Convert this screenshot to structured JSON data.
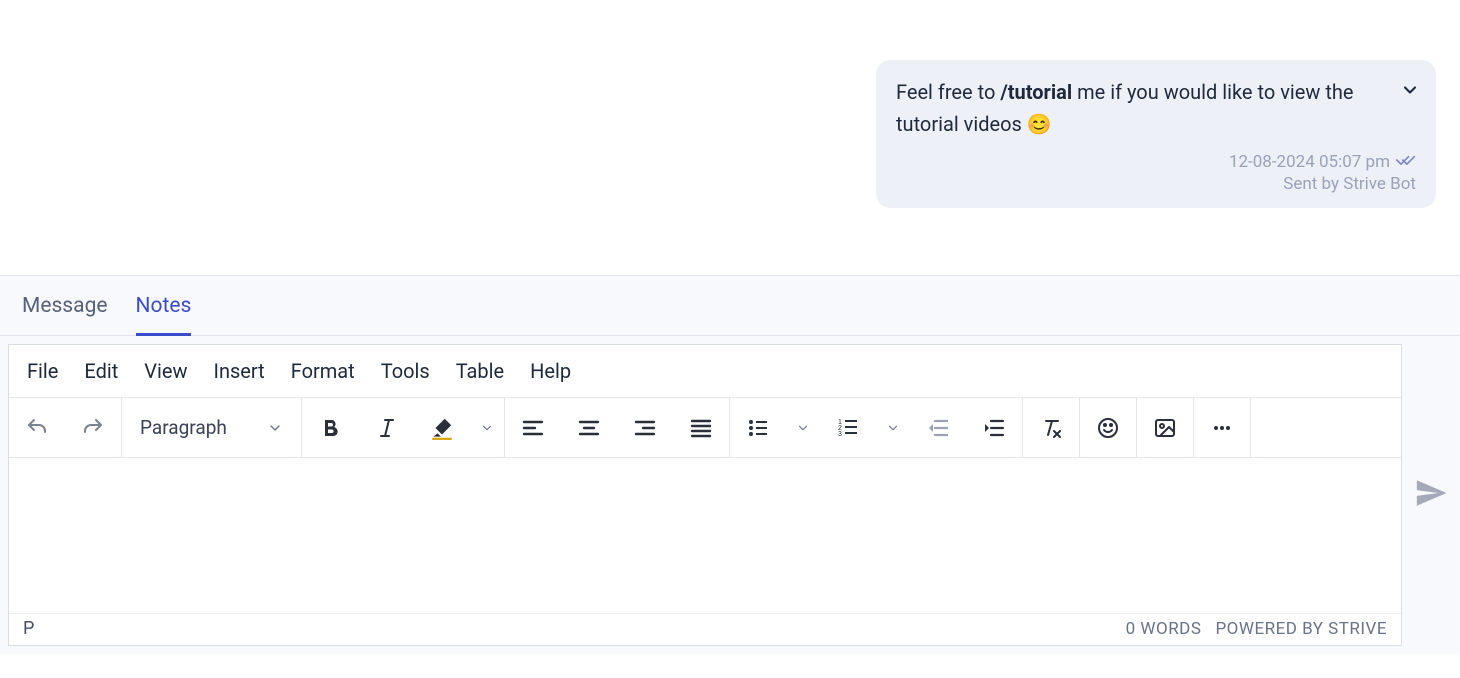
{
  "chat": {
    "message": {
      "prefix": "Feel free to ",
      "command": "/tutorial",
      "suffix": " me if you would like to view the tutorial videos ",
      "emoji": "😊",
      "timestamp": "12-08-2024 05:07 pm",
      "sender": "Sent by Strive Bot"
    }
  },
  "composer": {
    "tabs": {
      "message": "Message",
      "notes": "Notes"
    }
  },
  "editor": {
    "menu": {
      "file": "File",
      "edit": "Edit",
      "view": "View",
      "insert": "Insert",
      "format": "Format",
      "tools": "Tools",
      "table": "Table",
      "help": "Help"
    },
    "block_format": "Paragraph",
    "status": {
      "path": "P",
      "word_count": "0 WORDS",
      "powered_by": "POWERED BY STRIVE"
    }
  }
}
